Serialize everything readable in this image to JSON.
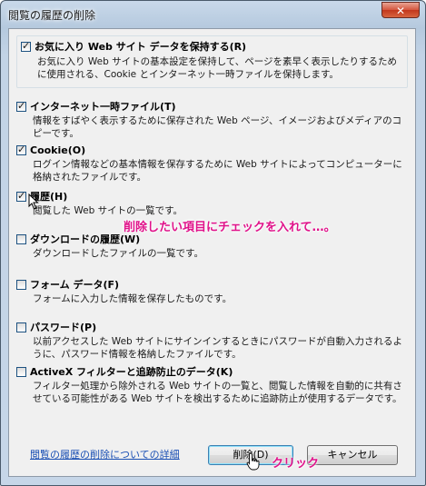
{
  "window": {
    "title": "閲覧の履歴の削除",
    "close_glyph": "✕"
  },
  "options": [
    {
      "label": "お気に入り Web サイト データを保持する(R)",
      "checked": true,
      "desc": "お気に入り Web サイトの基本設定を保持して、ページを素早く表示したりするために使用される、Cookie とインターネット一時ファイルを保持します。"
    },
    {
      "label": "インターネット一時ファイル(T)",
      "checked": true,
      "desc": "情報をすばやく表示するために保存された Web ページ、イメージおよびメディアのコピーです。"
    },
    {
      "label": "Cookie(O)",
      "checked": true,
      "desc": "ログイン情報などの基本情報を保存するために Web サイトによってコンピューターに格納されたファイルです。"
    },
    {
      "label": "履歴(H)",
      "checked": true,
      "desc": "閲覧した Web サイトの一覧です。"
    },
    {
      "label": "ダウンロードの履歴(W)",
      "checked": false,
      "desc": "ダウンロードしたファイルの一覧です。"
    },
    {
      "label": "フォーム データ(F)",
      "checked": false,
      "desc": "フォームに入力した情報を保存したものです。"
    },
    {
      "label": "パスワード(P)",
      "checked": false,
      "desc": "以前アクセスした Web サイトにサインインするときにパスワードが自動入力されるように、パスワード情報を格納したファイルです。"
    },
    {
      "label": "ActiveX フィルターと追跡防止のデータ(K)",
      "checked": false,
      "desc": "フィルター処理から除外される Web サイトの一覧と、閲覧した情報を自動的に共有させている可能性がある Web サイトを検出するために追跡防止が使用するデータです。"
    }
  ],
  "annotations": {
    "check_note": "削除したい項目にチェックを入れて…。",
    "click_note": "クリック"
  },
  "footer": {
    "link": "閲覧の履歴の削除についての詳細",
    "delete_button": "削除(D)",
    "cancel_button": "キャンセル"
  }
}
